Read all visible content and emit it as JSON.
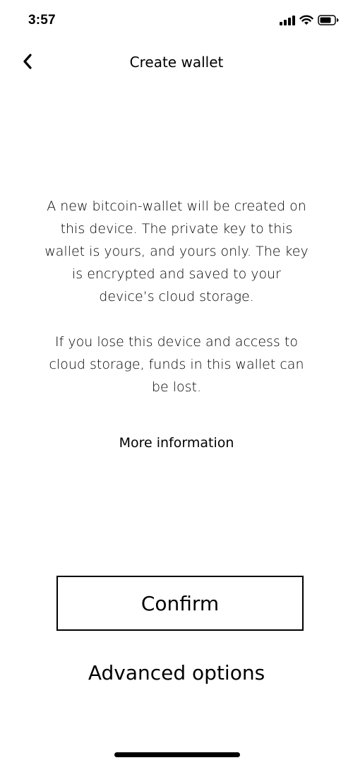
{
  "status_bar": {
    "time": "3:57",
    "icons": [
      "signal-icon",
      "wifi-icon",
      "battery-icon"
    ]
  },
  "nav": {
    "back_icon": "chevron-left-icon",
    "title": "Create wallet"
  },
  "main": {
    "paragraph_1": "A new bitcoin-wallet will be created on this device. The private key to this wallet is yours, and yours only. The key is encrypted and saved to your device’s cloud storage.",
    "paragraph_2": "If you lose this device and access to cloud storage, funds in this wallet can be lost.",
    "more_info_label": "More information"
  },
  "actions": {
    "confirm_label": "Confirm",
    "advanced_label": "Advanced options"
  }
}
